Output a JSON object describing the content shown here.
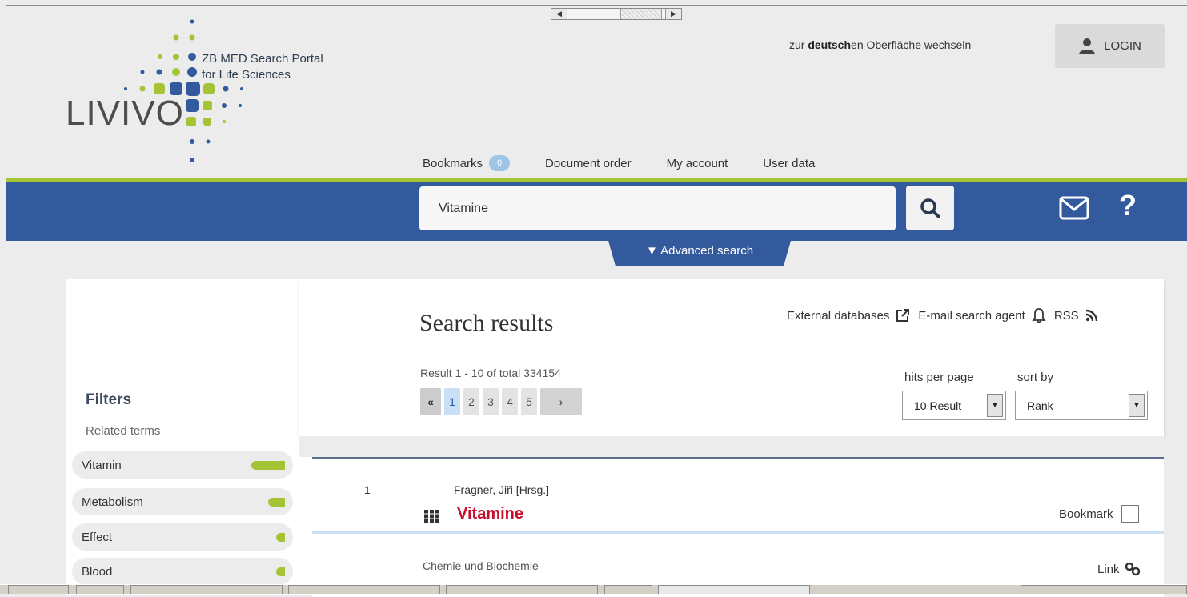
{
  "header": {
    "portal_line1": "ZB MED Search Portal",
    "portal_line2": "for Life Sciences",
    "logo_text": "LIVIVO",
    "language_prefix": "zur ",
    "language_bold": "deutsch",
    "language_suffix": "en Oberfläche wechseln",
    "login_label": "LOGIN"
  },
  "topnav": {
    "bookmarks_label": "Bookmarks",
    "bookmarks_count": "0",
    "document_order": "Document order",
    "my_account": "My account",
    "user_data": "User data"
  },
  "search": {
    "query": "Vitamine",
    "advanced_label": "▼ Advanced search"
  },
  "results": {
    "title": "Search results",
    "external_databases": "External databases",
    "email_agent": "E-mail search agent",
    "rss": "RSS",
    "count_text": "Result 1 - 10 of total 334154",
    "pager": {
      "first": "«",
      "pages": [
        "1",
        "2",
        "3",
        "4",
        "5"
      ],
      "current": "1",
      "next": "›"
    },
    "hits_per_page_label": "hits per page",
    "hits_per_page_value": "10 Result",
    "sort_by_label": "sort by",
    "sort_by_value": "Rank"
  },
  "filters": {
    "title": "Filters",
    "related_label": "Related terms",
    "terms": [
      {
        "label": "Vitamin",
        "weight": 1.0
      },
      {
        "label": "Metabolism",
        "weight": 0.5
      },
      {
        "label": "Effect",
        "weight": 0.25
      },
      {
        "label": "Blood",
        "weight": 0.25
      }
    ]
  },
  "result_items": [
    {
      "number": "1",
      "author": "Fragner, Jiři [Hrsg.]",
      "title": "Vitamine",
      "bookmark_label": "Bookmark",
      "subject": "Chemie und Biochemie",
      "link_label": "Link"
    }
  ],
  "colors": {
    "brand_blue": "#335a9c",
    "brand_green": "#a4c436",
    "title_red": "#c8102e"
  }
}
